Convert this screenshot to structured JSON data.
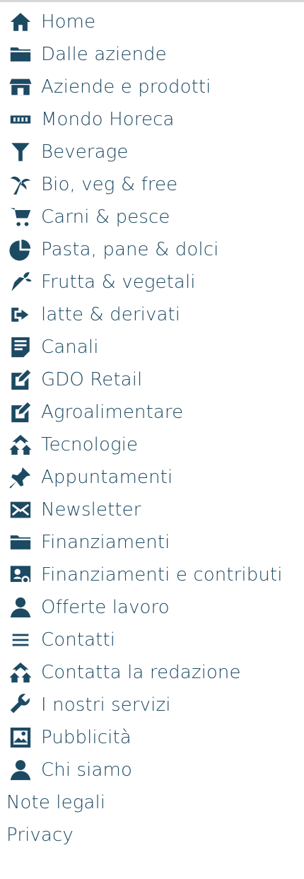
{
  "menu": {
    "items": [
      {
        "label": "Home",
        "icon": "home-icon"
      },
      {
        "label": "Dalle aziende",
        "icon": "folder-icon"
      },
      {
        "label": "Aziende e prodotti",
        "icon": "shop-icon"
      },
      {
        "label": "Mondo Horeca",
        "icon": "film-icon"
      },
      {
        "label": "Beverage",
        "icon": "funnel-icon"
      },
      {
        "label": "Bio, veg & free",
        "icon": "palm-tree-icon"
      },
      {
        "label": "Carni & pesce",
        "icon": "cart-icon"
      },
      {
        "label": "Pasta, pane & dolci",
        "icon": "pie-chart-icon"
      },
      {
        "label": "Frutta & vegetali",
        "icon": "carrot-icon"
      },
      {
        "label": "latte & derivati",
        "icon": "share-icon"
      },
      {
        "label": "Canali",
        "icon": "document-icon"
      },
      {
        "label": "GDO Retail",
        "icon": "edit-icon"
      },
      {
        "label": "Agroalimentare",
        "icon": "edit-icon"
      },
      {
        "label": "Tecnologie",
        "icon": "houses-icon"
      },
      {
        "label": "Appuntamenti",
        "icon": "pin-icon"
      },
      {
        "label": "Newsletter",
        "icon": "envelope-icon"
      },
      {
        "label": "Finanziamenti",
        "icon": "folder-icon"
      },
      {
        "label": "Finanziamenti e contributi",
        "icon": "contact-card-icon"
      },
      {
        "label": "Offerte lavoro",
        "icon": "user-icon"
      },
      {
        "label": "Contatti",
        "icon": "menu-icon"
      },
      {
        "label": "Contatta la redazione",
        "icon": "houses-icon"
      },
      {
        "label": "I nostri servizi",
        "icon": "wrench-icon"
      },
      {
        "label": "Pubblicità",
        "icon": "image-icon"
      },
      {
        "label": "Chi siamo",
        "icon": "user-icon"
      },
      {
        "label": "Note legali",
        "icon": ""
      },
      {
        "label": "Privacy",
        "icon": ""
      }
    ]
  },
  "colors": {
    "text": "#1d4a63",
    "border": "#d7d7d7",
    "background": "#ffffff"
  }
}
